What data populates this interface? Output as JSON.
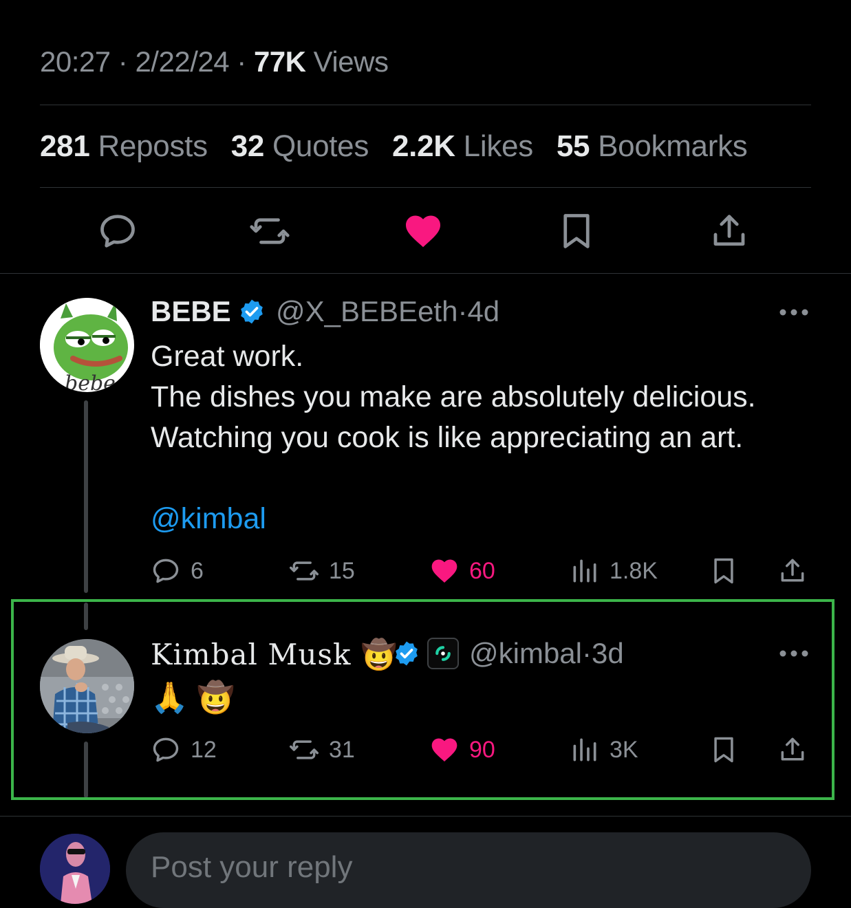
{
  "post_meta": {
    "time": "20:27",
    "sep1": "·",
    "date": "2/22/24",
    "sep2": "·",
    "views_count": "77K",
    "views_label": "Views"
  },
  "post_stats": [
    {
      "count": "281",
      "label": "Reposts"
    },
    {
      "count": "32",
      "label": "Quotes"
    },
    {
      "count": "2.2K",
      "label": "Likes"
    },
    {
      "count": "55",
      "label": "Bookmarks"
    }
  ],
  "action_bar": {
    "icons": [
      "reply-icon",
      "repost-icon",
      "like-icon-filled",
      "bookmark-icon",
      "share-icon"
    ],
    "like_color": "#f91880"
  },
  "replies": [
    {
      "display_name": "BEBE",
      "verified": true,
      "handle": "@X_BEBEeth",
      "sep": "·",
      "age": "4d",
      "avatar_text": "bebe",
      "body_lines": [
        "Great work.",
        "The dishes you make are absolutely delicious.",
        "Watching you cook is like appreciating an art.",
        "",
        "@kimbal"
      ],
      "metrics": {
        "replies": "6",
        "reposts": "15",
        "likes": "60",
        "views": "1.8K"
      }
    },
    {
      "display_name": "Kimbal Musk",
      "name_emoji": "🤠",
      "verified": true,
      "handle": "@kimbal",
      "sep": "·",
      "age": "3d",
      "body": "🙏 🤠",
      "metrics": {
        "replies": "12",
        "reposts": "31",
        "likes": "90",
        "views": "3K"
      }
    }
  ],
  "composer": {
    "placeholder": "Post your reply"
  },
  "colors": {
    "background": "#000000",
    "text": "#e7e9ea",
    "muted": "#8b9096",
    "link": "#1d9bf0",
    "like": "#f91880",
    "verified": "#1d9bf0",
    "highlight": "#3cb54a"
  }
}
